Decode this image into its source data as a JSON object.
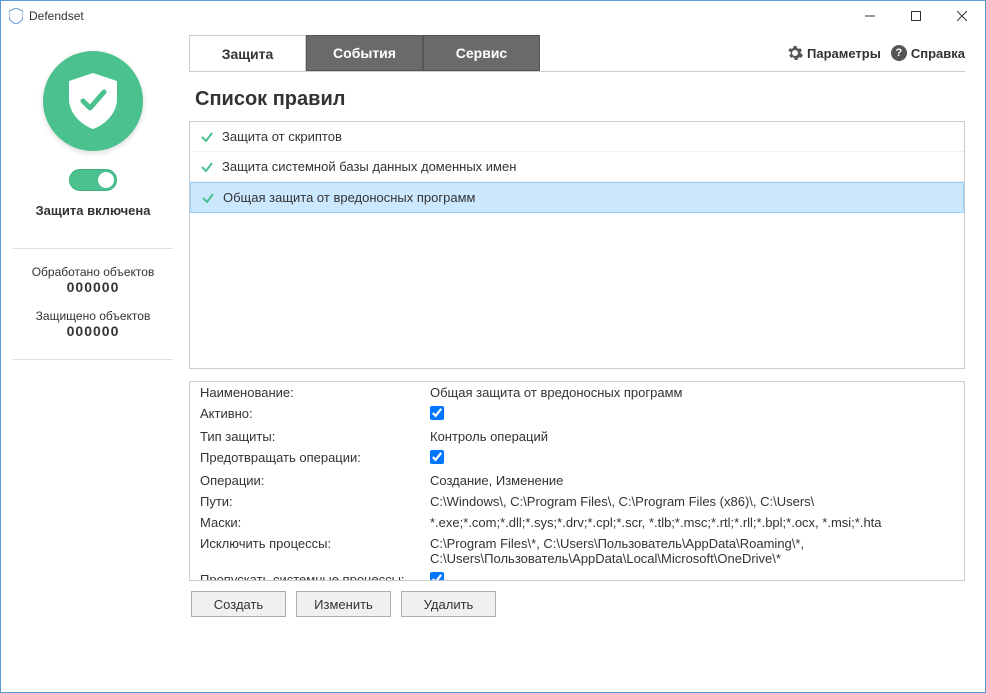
{
  "window": {
    "title": "Defendset"
  },
  "sidebar": {
    "status_text": "Защита включена",
    "stat1_label": "Обработано объектов",
    "stat1_value": "000000",
    "stat2_label": "Защищено объектов",
    "stat2_value": "000000"
  },
  "tabs": {
    "t1": "Защита",
    "t2": "События",
    "t3": "Сервис"
  },
  "toplinks": {
    "params": "Параметры",
    "help": "Справка"
  },
  "section_title": "Список правил",
  "rules": {
    "r1": "Защита от скриптов",
    "r2": "Защита системной базы данных доменных имен",
    "r3": "Общая защита от вредоносных программ"
  },
  "details": {
    "name_label": "Наименование:",
    "name_value": "Общая защита от вредоносных программ",
    "active_label": "Активно:",
    "type_label": "Тип защиты:",
    "type_value": "Контроль операций",
    "prevent_label": "Предотвращать операции:",
    "ops_label": "Операции:",
    "ops_value": "Создание, Изменение",
    "paths_label": "Пути:",
    "paths_value": "C:\\Windows\\, C:\\Program Files\\, C:\\Program Files (x86)\\, C:\\Users\\",
    "masks_label": "Маски:",
    "masks_value": "*.exe;*.com;*.dll;*.sys;*.drv;*.cpl;*.scr, *.tlb;*.msc;*.rtl;*.rll;*.bpl;*.ocx, *.msi;*.hta",
    "exclude_label": "Исключить процессы:",
    "exclude_value": "C:\\Program Files\\*, C:\\Users\\Пользователь\\AppData\\Roaming\\*, C:\\Users\\Пользователь\\AppData\\Local\\Microsoft\\OneDrive\\*",
    "skip_label": "Пропускать системные процессы:"
  },
  "buttons": {
    "create": "Создать",
    "edit": "Изменить",
    "delete": "Удалить"
  }
}
